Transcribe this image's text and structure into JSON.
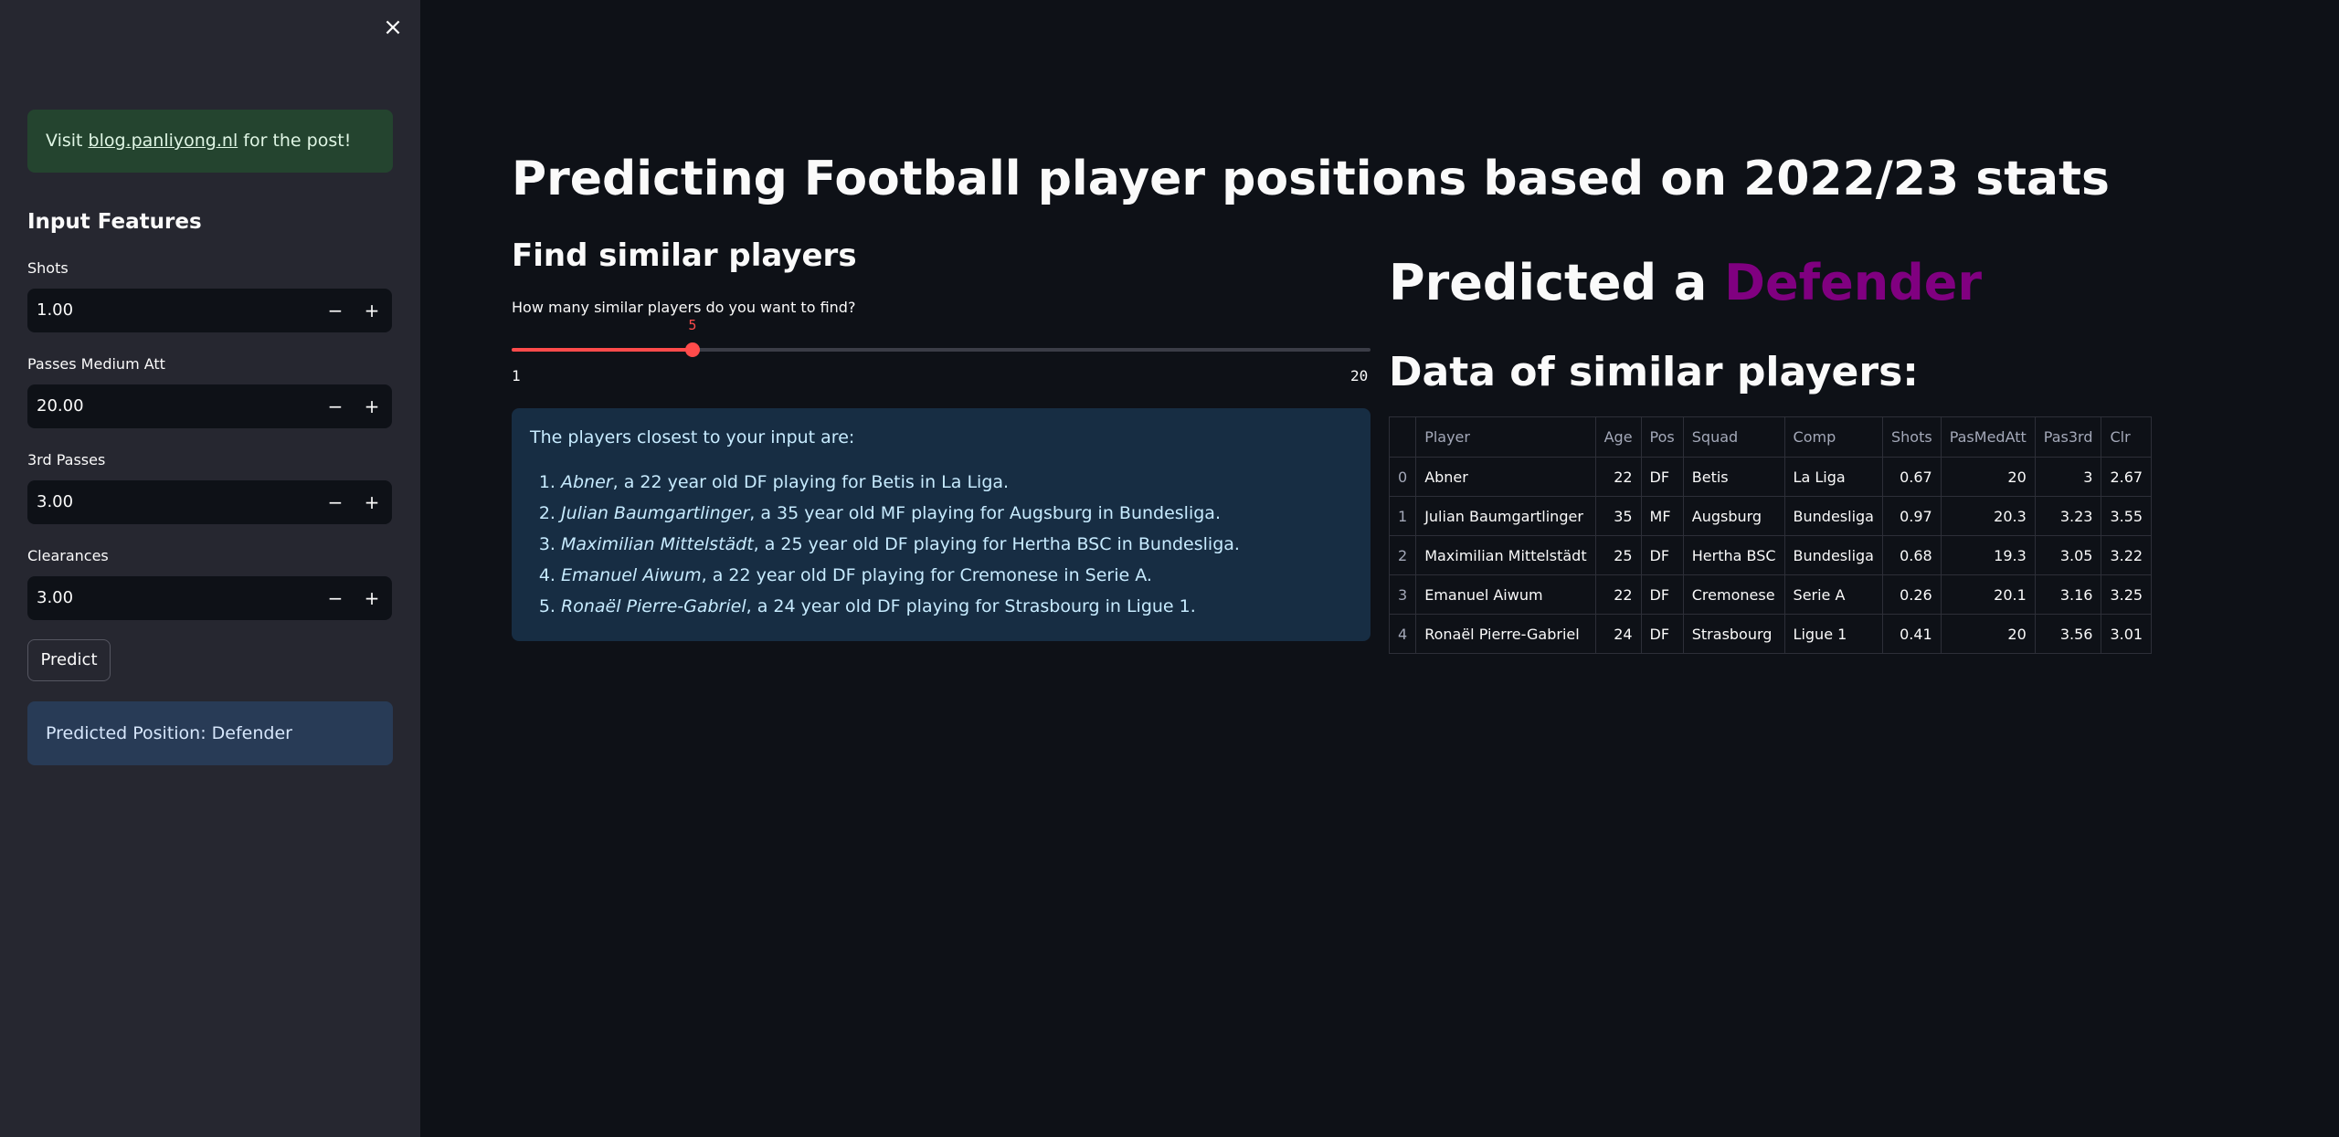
{
  "sidebar": {
    "close_label": "×",
    "visit": {
      "prefix": "Visit ",
      "link": "blog.panliyong.nl",
      "suffix": " for the post!"
    },
    "heading": "Input Features",
    "fields": [
      {
        "label": "Shots",
        "value": "1.00"
      },
      {
        "label": "Passes Medium Att",
        "value": "20.00"
      },
      {
        "label": "3rd Passes",
        "value": "3.00"
      },
      {
        "label": "Clearances",
        "value": "3.00"
      }
    ],
    "minus": "−",
    "plus": "+",
    "predict_label": "Predict",
    "predicted_position": "Predicted Position: Defender"
  },
  "main": {
    "title": "Predicting Football player positions based on 2022/23 stats",
    "similar_heading": "Find similar players",
    "slider": {
      "label": "How many similar players do you want to find?",
      "value": 5,
      "min": 1,
      "max": 20
    },
    "closest_intro": "The players closest to your input are:",
    "closest": [
      {
        "name": "Abner",
        "text": ", a 22 year old DF playing for Betis in La Liga."
      },
      {
        "name": "Julian Baumgartlinger",
        "text": ", a 35 year old MF playing for Augsburg in Bundesliga."
      },
      {
        "name": "Maximilian Mittelstädt",
        "text": ", a 25 year old DF playing for Hertha BSC in Bundesliga."
      },
      {
        "name": "Emanuel Aiwum",
        "text": ", a 22 year old DF playing for Cremonese in Serie A."
      },
      {
        "name": "Ronaël Pierre-Gabriel",
        "text": ", a 24 year old DF playing for Strasbourg in Ligue 1."
      }
    ],
    "predicted_prefix": "Predicted a ",
    "predicted_value": "Defender",
    "predicted_color": "#800080",
    "data_heading": "Data of similar players:",
    "table": {
      "columns": [
        "",
        "Player",
        "Age",
        "Pos",
        "Squad",
        "Comp",
        "Shots",
        "PasMedAtt",
        "Pas3rd",
        "Clr"
      ],
      "rows": [
        [
          "0",
          "Abner",
          "22",
          "DF",
          "Betis",
          "La Liga",
          "0.67",
          "20",
          "3",
          "2.67"
        ],
        [
          "1",
          "Julian Baumgartlinger",
          "35",
          "MF",
          "Augsburg",
          "Bundesliga",
          "0.97",
          "20.3",
          "3.23",
          "3.55"
        ],
        [
          "2",
          "Maximilian Mittelstädt",
          "25",
          "DF",
          "Hertha BSC",
          "Bundesliga",
          "0.68",
          "19.3",
          "3.05",
          "3.22"
        ],
        [
          "3",
          "Emanuel Aiwum",
          "22",
          "DF",
          "Cremonese",
          "Serie A",
          "0.26",
          "20.1",
          "3.16",
          "3.25"
        ],
        [
          "4",
          "Ronaël Pierre-Gabriel",
          "24",
          "DF",
          "Strasbourg",
          "Ligue 1",
          "0.41",
          "20",
          "3.56",
          "3.01"
        ]
      ]
    }
  },
  "colors": {
    "accent": "#ff4b4b",
    "background": "#0e1117",
    "sidebar": "#262730"
  }
}
